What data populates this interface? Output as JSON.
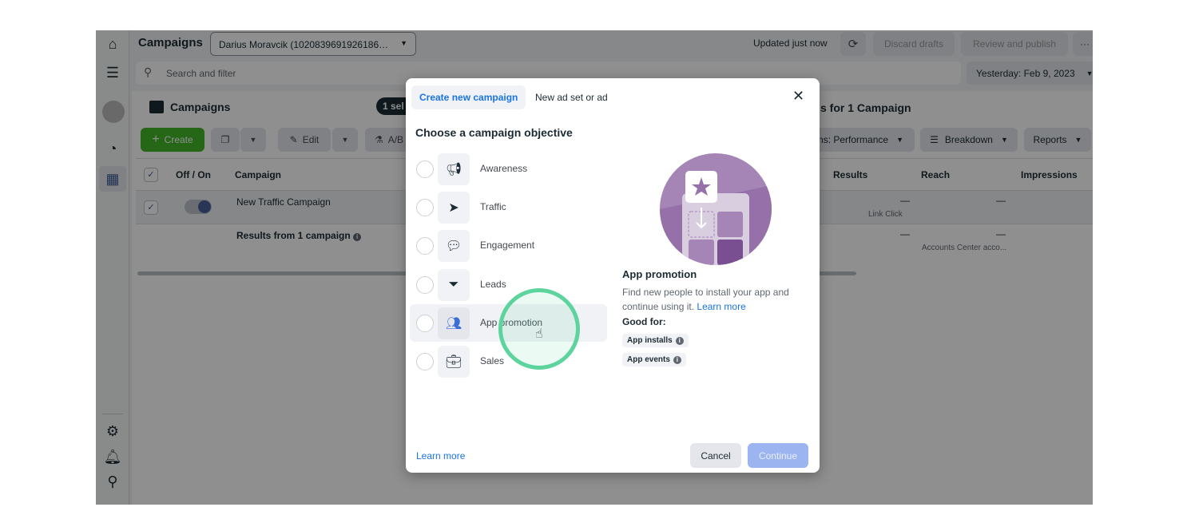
{
  "topbar": {
    "title": "Campaigns",
    "account": "Darius Moravcik (1020839691926186…",
    "updated": "Updated just now",
    "discard": "Discard drafts",
    "review": "Review and publish",
    "more": "···"
  },
  "search": {
    "placeholder": "Search and filter",
    "date": "Yesterday: Feb 9, 2023"
  },
  "panel": {
    "title": "Campaigns",
    "selected_badge": "1 sel",
    "right_title": "s for 1 Campaign"
  },
  "actions": {
    "create": "Create",
    "edit": "Edit",
    "ab": "A/B",
    "columns": "ns: Performance",
    "breakdown": "Breakdown",
    "reports": "Reports"
  },
  "table": {
    "headers": [
      "Off / On",
      "Campaign",
      "Results",
      "Reach",
      "Impressions"
    ],
    "rows": [
      {
        "campaign": "New Traffic Campaign",
        "results": "—",
        "results_sub": "Link Click",
        "reach": "—"
      }
    ],
    "summary": {
      "label": "Results from 1 campaign",
      "results": "—",
      "reach": "—",
      "reach_sub": "Accounts Center acco..."
    }
  },
  "modal": {
    "tabs": [
      "Create new campaign",
      "New ad set or ad"
    ],
    "heading": "Choose a campaign objective",
    "objectives": [
      {
        "label": "Awareness",
        "icon": "megaphone-icon"
      },
      {
        "label": "Traffic",
        "icon": "cursor-icon"
      },
      {
        "label": "Engagement",
        "icon": "chat-bubbles-icon"
      },
      {
        "label": "Leads",
        "icon": "funnel-icon"
      },
      {
        "label": "App promotion",
        "icon": "people-icon",
        "selected": true
      },
      {
        "label": "Sales",
        "icon": "briefcase-icon"
      }
    ],
    "detail": {
      "title": "App promotion",
      "desc": "Find new people to install your app and continue using it.",
      "learn": "Learn more",
      "good_for": "Good for:",
      "chips": [
        "App installs",
        "App events"
      ]
    },
    "footer": {
      "learn": "Learn more",
      "cancel": "Cancel",
      "continue": "Continue"
    }
  },
  "colors": {
    "accent": "#1b74e4",
    "create_green": "#42b72a",
    "continue_disabled": "#9cb4f0",
    "highlight_ring": "#5dd39e",
    "illustration": "#a585b5"
  }
}
